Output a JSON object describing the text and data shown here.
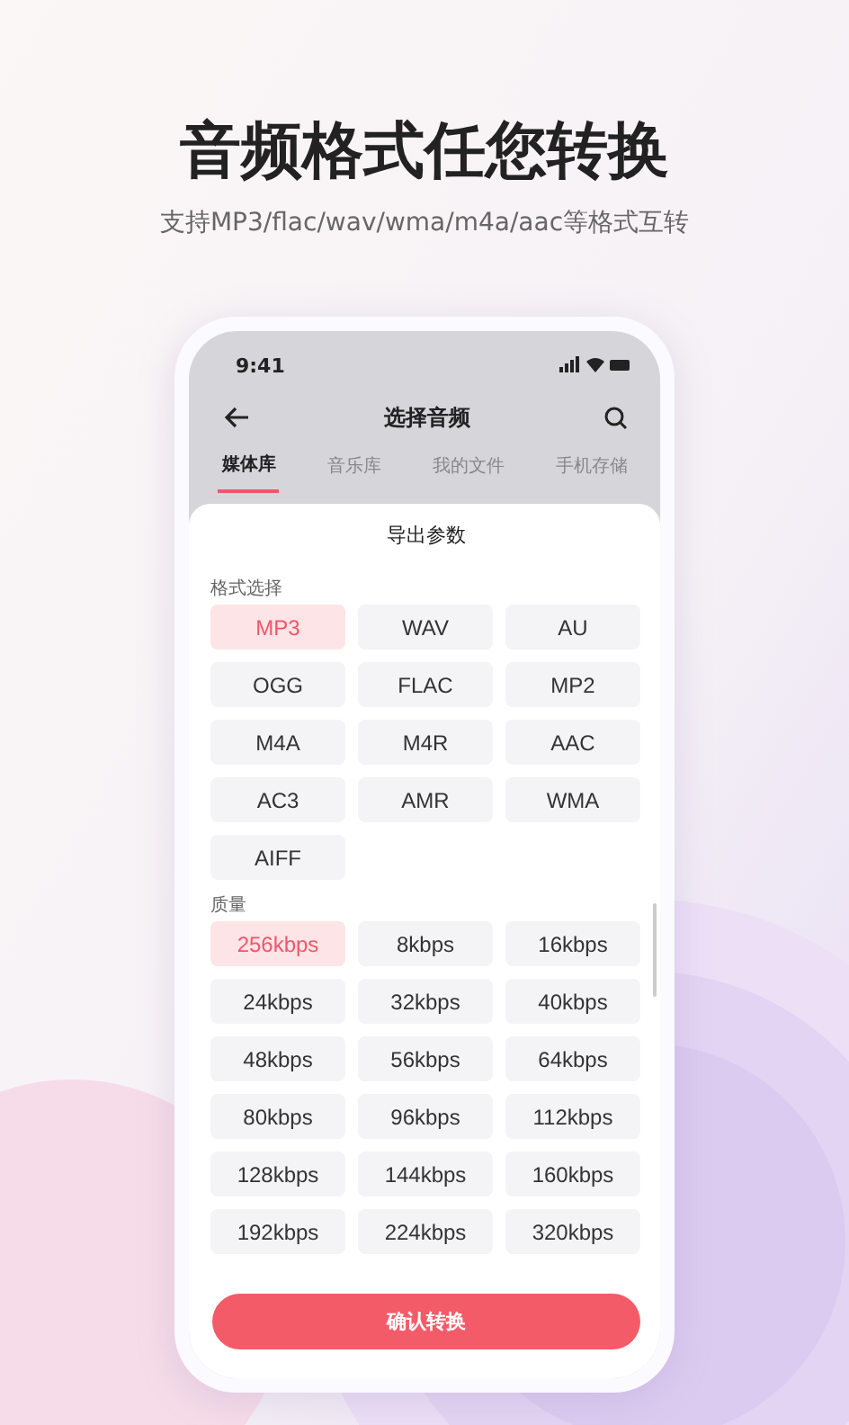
{
  "headline": "音频格式任您转换",
  "subtitle": "支持MP3/flac/wav/wma/m4a/aac等格式互转",
  "status_bar": {
    "time": "9:41"
  },
  "nav": {
    "title": "选择音频"
  },
  "tabs": [
    {
      "label": "媒体库",
      "selected": true
    },
    {
      "label": "音乐库",
      "selected": false
    },
    {
      "label": "我的文件",
      "selected": false
    },
    {
      "label": "手机存储",
      "selected": false
    }
  ],
  "sheet": {
    "title": "导出参数",
    "sections": [
      {
        "label": "格式选择",
        "options": [
          {
            "label": "MP3",
            "selected": true
          },
          {
            "label": "WAV",
            "selected": false
          },
          {
            "label": "AU",
            "selected": false
          },
          {
            "label": "OGG",
            "selected": false
          },
          {
            "label": "FLAC",
            "selected": false
          },
          {
            "label": "MP2",
            "selected": false
          },
          {
            "label": "M4A",
            "selected": false
          },
          {
            "label": "M4R",
            "selected": false
          },
          {
            "label": "AAC",
            "selected": false
          },
          {
            "label": "AC3",
            "selected": false
          },
          {
            "label": "AMR",
            "selected": false
          },
          {
            "label": "WMA",
            "selected": false
          },
          {
            "label": "AIFF",
            "selected": false
          }
        ]
      },
      {
        "label": "质量",
        "options": [
          {
            "label": "256kbps",
            "selected": true
          },
          {
            "label": "8kbps",
            "selected": false
          },
          {
            "label": "16kbps",
            "selected": false
          },
          {
            "label": "24kbps",
            "selected": false
          },
          {
            "label": "32kbps",
            "selected": false
          },
          {
            "label": "40kbps",
            "selected": false
          },
          {
            "label": "48kbps",
            "selected": false
          },
          {
            "label": "56kbps",
            "selected": false
          },
          {
            "label": "64kbps",
            "selected": false
          },
          {
            "label": "80kbps",
            "selected": false
          },
          {
            "label": "96kbps",
            "selected": false
          },
          {
            "label": "112kbps",
            "selected": false
          },
          {
            "label": "128kbps",
            "selected": false
          },
          {
            "label": "144kbps",
            "selected": false
          },
          {
            "label": "160kbps",
            "selected": false
          },
          {
            "label": "192kbps",
            "selected": false
          },
          {
            "label": "224kbps",
            "selected": false
          },
          {
            "label": "320kbps",
            "selected": false
          }
        ]
      }
    ],
    "confirm_button": "确认转换"
  }
}
